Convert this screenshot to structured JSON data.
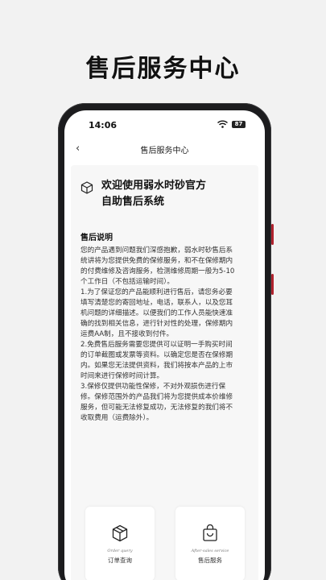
{
  "promo": {
    "title": "售后服务中心"
  },
  "status_bar": {
    "time": "14:06",
    "battery": "87"
  },
  "nav": {
    "title": "售后服务中心"
  },
  "welcome": {
    "line1": "欢迎使用弱水时砂官方",
    "line2": "自助售后系统"
  },
  "section": {
    "title": "售后说明",
    "lines": [
      "您的产品遇到问题我们深感抱歉，弱水时砂售后系",
      "统讲将为您提供免费的保修服务，和不在保修期内",
      "的付费维修及咨询服务，检测维修周期一般为5-10",
      "个工作日（不包括运输时间）。",
      "1.为了保证您的产品能顺利进行售后，请您务必要",
      "填写清楚您的寄回地址，电话，联系人，以及您耳",
      "机问题的详细描述。以便我们的工作人员能快速准",
      "确的找到相关信息，进行针对性的处理，保修期内",
      "运费AA制，且不接收到付件。",
      "2.免费售后服务需要您提供可以证明一手购买时间",
      "的订单截图或发票等资料。以确定您是否在保修期",
      "内。如果您无法提供资料，我们将按本产品的上市",
      "时间来进行保修时间计算。",
      "3.保修仅提供功能性保修，不对外观损伤进行保",
      "修。保修范围外的产品我们将为您提供成本价维修",
      "服务，但可能无法修复成功，无法修复的我们将不",
      "收取费用（运费除外）。"
    ]
  },
  "cards": {
    "order": {
      "en": "Order query",
      "cn": "订单查询"
    },
    "service": {
      "en": "After-sales service",
      "cn": "售后服务"
    }
  }
}
